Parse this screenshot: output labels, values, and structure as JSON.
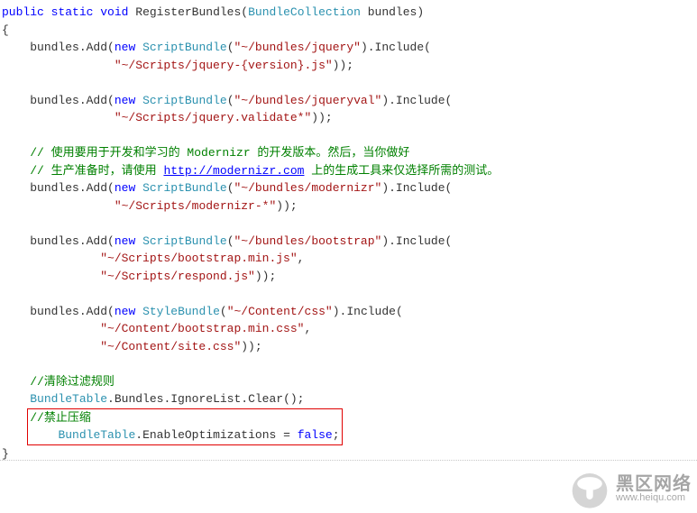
{
  "sig": {
    "kw1": "public",
    "kw2": "static",
    "kw3": "void",
    "method": " RegisterBundles(",
    "type": "BundleCollection",
    "tail": " bundles)"
  },
  "brace_open": "{",
  "brace_close": "}",
  "indent1": "    ",
  "l1": {
    "a": "bundles.Add(",
    "new": "new",
    "sp": " ",
    "cls": "ScriptBundle",
    "b": "(",
    "s": "\"~/bundles/jquery\"",
    "c": ").Include("
  },
  "l2": {
    "pad": "                ",
    "s": "\"~/Scripts/jquery-{version}.js\"",
    "e": "));"
  },
  "l3": {
    "a": "bundles.Add(",
    "new": "new",
    "sp": " ",
    "cls": "ScriptBundle",
    "b": "(",
    "s": "\"~/bundles/jqueryval\"",
    "c": ").Include("
  },
  "l4": {
    "pad": "                ",
    "s": "\"~/Scripts/jquery.validate*\"",
    "e": "));"
  },
  "c1": "// 使用要用于开发和学习的 Modernizr 的开发版本。然后，当你做好",
  "c2a": "// 生产准备时，请使用 ",
  "c2link": "http://modernizr.com",
  "c2b": " 上的生成工具来仅选择所需的测试。",
  "l5": {
    "a": "bundles.Add(",
    "new": "new",
    "sp": " ",
    "cls": "ScriptBundle",
    "b": "(",
    "s": "\"~/bundles/modernizr\"",
    "c": ").Include("
  },
  "l6": {
    "pad": "                ",
    "s": "\"~/Scripts/modernizr-*\"",
    "e": "));"
  },
  "l7": {
    "a": "bundles.Add(",
    "new": "new",
    "sp": " ",
    "cls": "ScriptBundle",
    "b": "(",
    "s": "\"~/bundles/bootstrap\"",
    "c": ").Include("
  },
  "l8": {
    "pad": "              ",
    "s": "\"~/Scripts/bootstrap.min.js\"",
    "e": ","
  },
  "l9": {
    "pad": "              ",
    "s": "\"~/Scripts/respond.js\"",
    "e": "));"
  },
  "l10": {
    "a": "bundles.Add(",
    "new": "new",
    "sp": " ",
    "cls": "StyleBundle",
    "b": "(",
    "s": "\"~/Content/css\"",
    "c": ").Include("
  },
  "l11": {
    "pad": "              ",
    "s": "\"~/Content/bootstrap.min.css\"",
    "e": ","
  },
  "l12": {
    "pad": "              ",
    "s": "\"~/Content/site.css\"",
    "e": "));"
  },
  "c3": "//清除过滤规则",
  "l13": {
    "cls": "BundleTable",
    "tail": ".Bundles.IgnoreList.Clear();"
  },
  "c4": "//禁止压缩",
  "l14": {
    "cls": "BundleTable",
    "mid": ".EnableOptimizations = ",
    "false": "false",
    "e": ";"
  },
  "watermark": {
    "cn": "黑区网络",
    "url": "www.heiqu.com"
  }
}
